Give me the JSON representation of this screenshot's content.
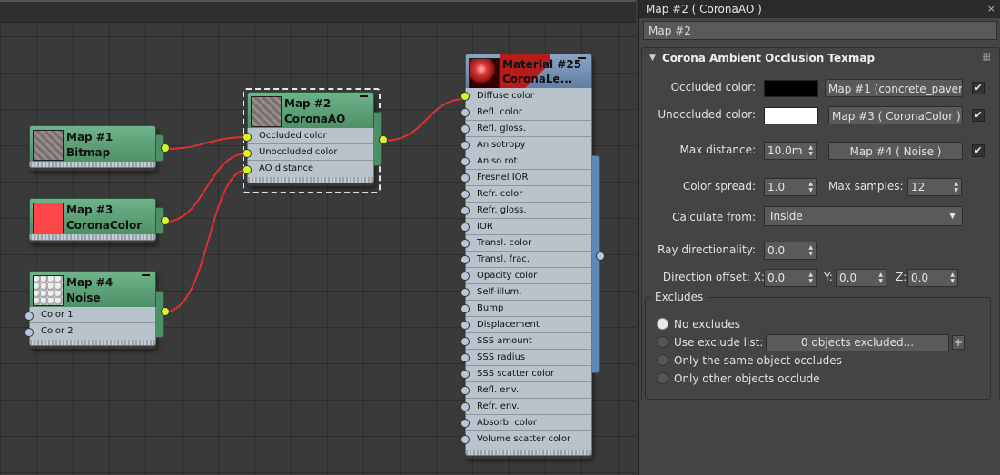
{
  "nodes": {
    "map1": {
      "title1": "Map #1",
      "title2": "Bitmap"
    },
    "map3": {
      "title1": "Map #3",
      "title2": "CoronaColor"
    },
    "map4": {
      "title1": "Map #4",
      "title2": "Noise",
      "slots": [
        "Color 1",
        "Color 2"
      ]
    },
    "map2": {
      "title1": "Map #2",
      "title2": "CoronaAO",
      "slots": [
        "Occluded color",
        "Unoccluded color",
        "AO distance"
      ]
    },
    "mat25": {
      "title1": "Material #25",
      "title2": "CoronaLe...",
      "slots": [
        "Diffuse color",
        "Refl. color",
        "Refl. gloss.",
        "Anisotropy",
        "Aniso rot.",
        "Fresnel IOR",
        "Refr. color",
        "Refr. gloss.",
        "IOR",
        "Transl. color",
        "Transl. frac.",
        "Opacity color",
        "Self-illum.",
        "Bump",
        "Displacement",
        "SSS amount",
        "SSS radius",
        "SSS scatter color",
        "Refl. env.",
        "Refr. env.",
        "Absorb. color",
        "Volume scatter color"
      ]
    }
  },
  "panel": {
    "title": "Map #2  ( CoronaAO )",
    "close": "×",
    "name_field": "Map #2",
    "rollout_title": "Corona Ambient Occlusion Texmap",
    "occluded_label": "Occluded color:",
    "occluded_map": "Map #1 (concrete_pavem",
    "unoccluded_label": "Unoccluded color:",
    "unoccluded_map": "Map #3  ( CoronaColor )",
    "maxdist_label": "Max distance:",
    "maxdist_value": "10.0m",
    "maxdist_map": "Map #4  ( Noise )",
    "spread_label": "Color spread:",
    "spread_value": "1.0",
    "samples_label": "Max samples:",
    "samples_value": "12",
    "calc_label": "Calculate from:",
    "calc_value": "Inside",
    "raydir_label": "Ray directionality:",
    "raydir_value": "0.0",
    "diroff_label": "Direction offset: X:",
    "diroff_x": "0.0",
    "y_label": "Y:",
    "diroff_y": "0.0",
    "z_label": "Z:",
    "diroff_z": "0.0",
    "excludes_title": "Excludes",
    "opt_no_excludes": "No excludes",
    "opt_use_list": "Use exclude list:",
    "excluded_count": "0 objects excluded...",
    "opt_same_object": "Only the same object occludes",
    "opt_other_objects": "Only other objects occlude",
    "check": "✔",
    "plus": "+"
  },
  "colors": {
    "occluded_swatch": "#000000",
    "unoccluded_swatch": "#ffffff",
    "corona_color": "#ff4747",
    "wire": "#e03030"
  }
}
